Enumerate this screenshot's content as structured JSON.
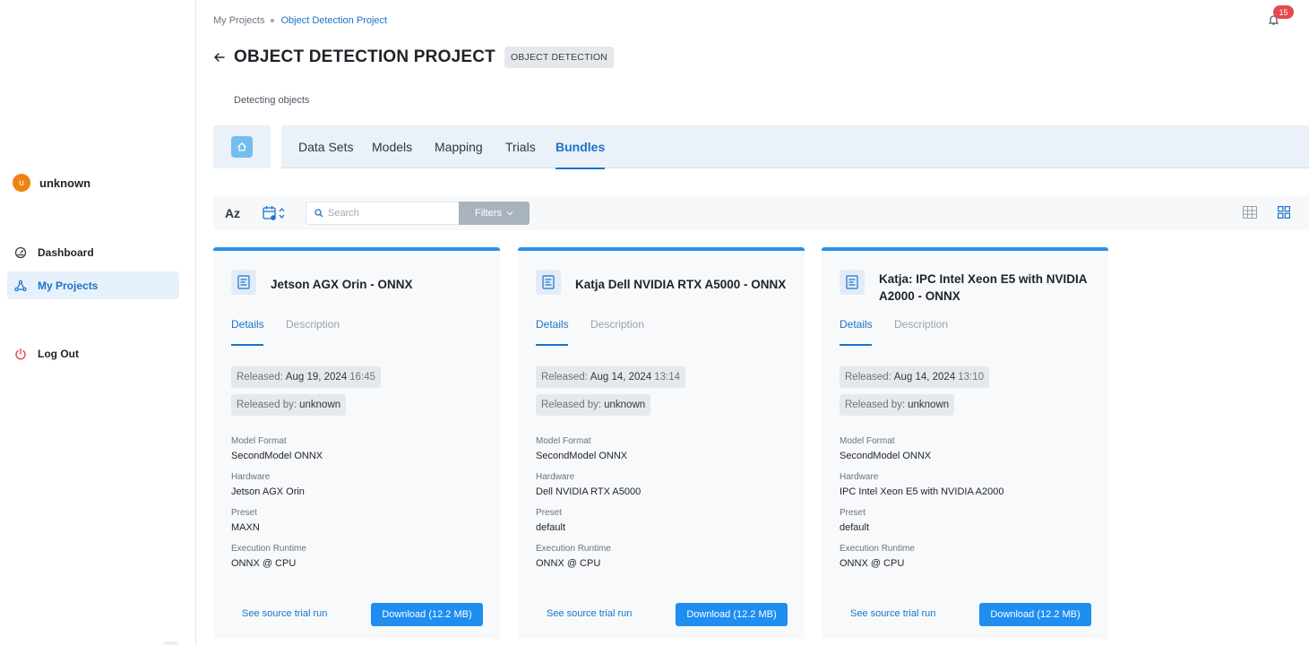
{
  "sidebar": {
    "user": {
      "initial": "u",
      "name": "unknown"
    },
    "nav": [
      {
        "label": "Dashboard",
        "icon": "dashboard-gauge-icon"
      },
      {
        "label": "My Projects",
        "icon": "projects-network-icon",
        "active": true
      },
      {
        "label": "Log Out",
        "icon": "power-icon"
      }
    ]
  },
  "breadcrumb": {
    "root": "My Projects",
    "current": "Object Detection Project"
  },
  "notifications": {
    "count": "15",
    "icon": "bell-icon"
  },
  "header": {
    "title": "OBJECT DETECTION PROJECT",
    "type": "OBJECT DETECTION",
    "subtitle": "Detecting objects"
  },
  "tabs": [
    {
      "label": "Data Sets"
    },
    {
      "label": "Models"
    },
    {
      "label": "Mapping"
    },
    {
      "label": "Trials"
    },
    {
      "label": "Bundles",
      "active": true
    }
  ],
  "toolbar": {
    "sort_az": "Az",
    "search_placeholder": "Search",
    "filters_label": "Filters"
  },
  "card_tabs": {
    "details": "Details",
    "description": "Description"
  },
  "labels": {
    "released": "Released:",
    "released_by": "Released by:",
    "model_format": "Model Format",
    "hardware": "Hardware",
    "preset": "Preset",
    "runtime": "Execution Runtime",
    "source_link": "See source trial run",
    "download": "Download (12.2 MB)"
  },
  "bundles": [
    {
      "title": "Jetson AGX Orin - ONNX",
      "released_date": "Aug 19, 2024",
      "released_time": "16:45",
      "released_by": "unknown",
      "model_format": "SecondModel ONNX",
      "hardware": "Jetson AGX Orin",
      "preset": "MAXN",
      "runtime": "ONNX @ CPU"
    },
    {
      "title": "Katja Dell NVIDIA RTX A5000 - ONNX",
      "released_date": "Aug 14, 2024",
      "released_time": "13:14",
      "released_by": "unknown",
      "model_format": "SecondModel ONNX",
      "hardware": "Dell NVIDIA RTX A5000",
      "preset": "default",
      "runtime": "ONNX @ CPU"
    },
    {
      "title": "Katja: IPC Intel Xeon E5 with NVIDIA A2000 - ONNX",
      "released_date": "Aug 14, 2024",
      "released_time": "13:10",
      "released_by": "unknown",
      "model_format": "SecondModel ONNX",
      "hardware": "IPC Intel Xeon E5 with NVIDIA A2000",
      "preset": "default",
      "runtime": "ONNX @ CPU"
    }
  ],
  "colors": {
    "accent": "#1a73c9",
    "button": "#1e8ef0",
    "card_top": "#2a91ea",
    "badge": "#e5484d",
    "avatar": "#f0820f"
  }
}
